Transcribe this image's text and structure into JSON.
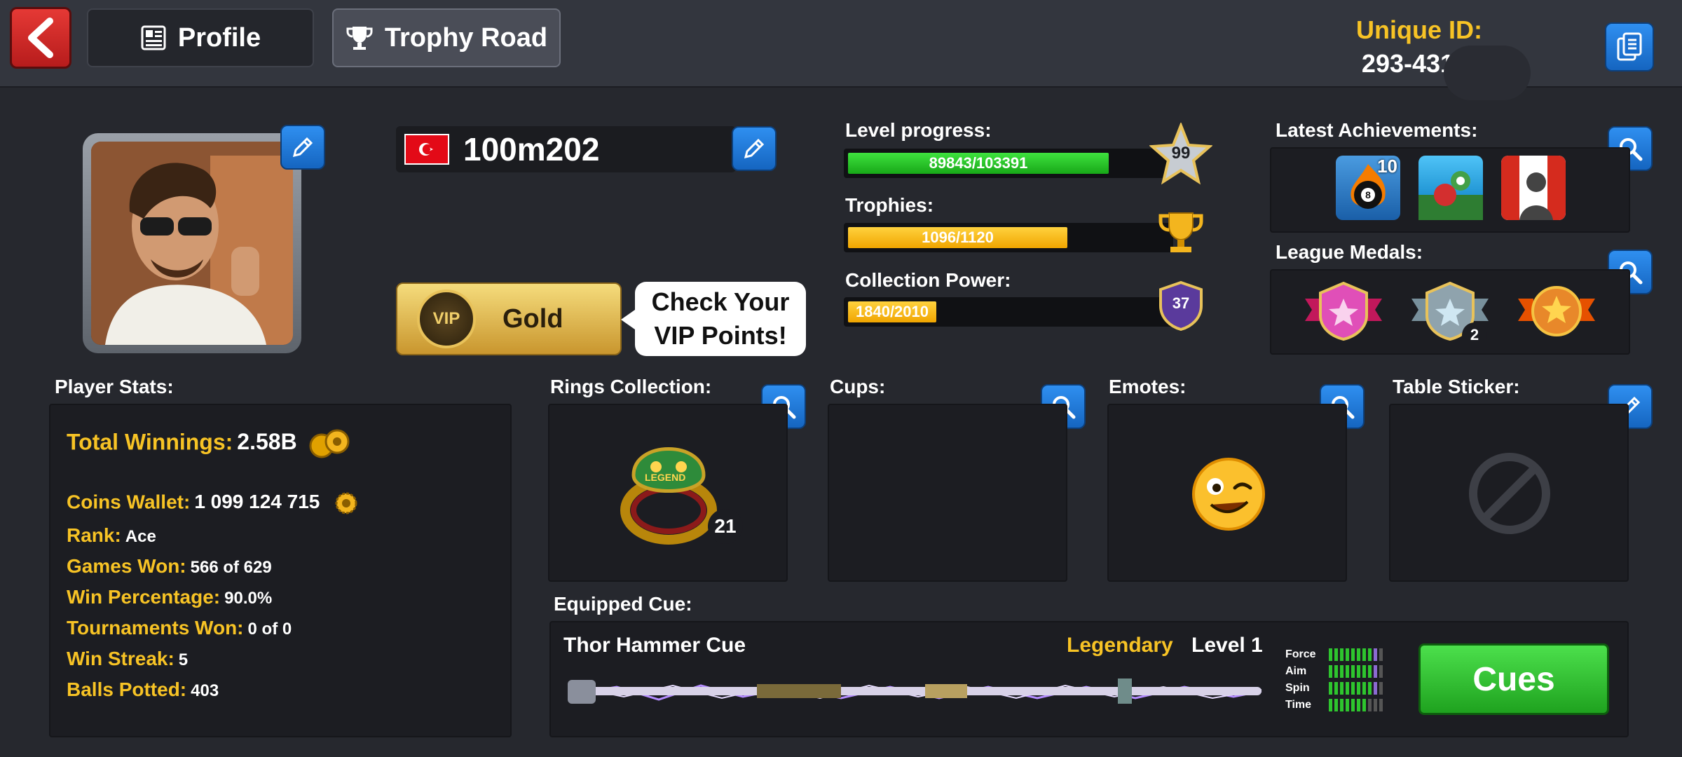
{
  "header": {
    "profile_tab": "Profile",
    "trophy_tab": "Trophy Road",
    "unique_id_label": "Unique ID:",
    "unique_id_value": "293-431-7"
  },
  "player": {
    "name": "100m202",
    "flag": "turkey-flag-icon",
    "vip_tier": "Gold",
    "vip_badge": "VIP",
    "vip_prompt": "Check Your VIP Points!"
  },
  "progress": {
    "level_label": "Level progress:",
    "level_text": "89843/103391",
    "level_value": 89843,
    "level_max": 103391,
    "level_badge": "99",
    "trophies_label": "Trophies:",
    "trophies_text": "1096/1120",
    "trophies_value": 1096,
    "trophies_max": 1120,
    "collection_label": "Collection Power:",
    "collection_text": "1840/2010",
    "collection_value": 1840,
    "collection_max": 2010,
    "collection_badge": "37"
  },
  "achievements": {
    "label": "Latest Achievements:",
    "badge_count": "10",
    "items": [
      "fire-8-ball-icon",
      "pool-ball-icon",
      "canada-flag-icon"
    ]
  },
  "league": {
    "label": "League Medals:",
    "silver_count": "2"
  },
  "stats": {
    "label": "Player Stats:",
    "total_winnings_label": "Total Winnings:",
    "total_winnings_value": "2.58B",
    "coins_label": "Coins Wallet:",
    "coins_value": "1 099 124 715",
    "rank_label": "Rank:",
    "rank_value": "Ace",
    "games_won_label": "Games Won:",
    "games_won_value": "566 of 629",
    "win_pct_label": "Win Percentage:",
    "win_pct_value": "90.0%",
    "tournaments_label": "Tournaments Won:",
    "tournaments_value": "0 of 0",
    "streak_label": "Win Streak:",
    "streak_value": "5",
    "potted_label": "Balls Potted:",
    "potted_value": "403"
  },
  "collections": {
    "rings_label": "Rings Collection:",
    "ring_count": "21",
    "ring_engraving": "LEGEND",
    "cups_label": "Cups:",
    "emotes_label": "Emotes:",
    "sticker_label": "Table Sticker:"
  },
  "cue": {
    "section_label": "Equipped Cue:",
    "name": "Thor Hammer Cue",
    "rarity": "Legendary",
    "level": "Level 1",
    "force_label": "Force",
    "aim_label": "Aim",
    "spin_label": "Spin",
    "time_label": "Time",
    "cues_button": "Cues"
  },
  "colors": {
    "accent_gold": "#f7c325",
    "button_blue": "#1e7be0",
    "button_red": "#d32f2f",
    "button_green": "#2fc42f"
  }
}
